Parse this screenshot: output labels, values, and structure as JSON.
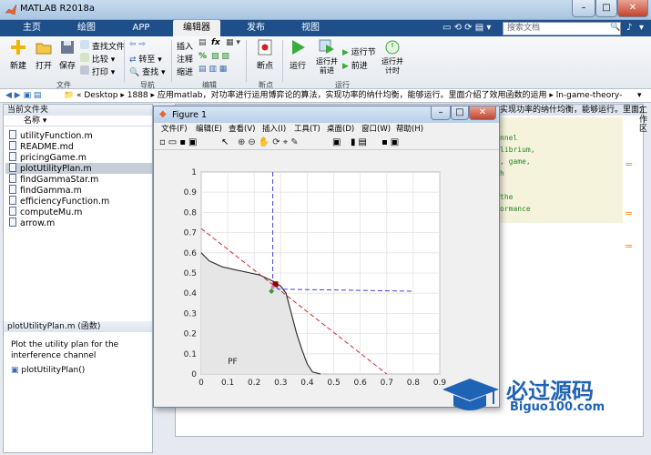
{
  "window": {
    "title": "MATLAB R2018a"
  },
  "tabs": [
    {
      "label": "主页",
      "active": false
    },
    {
      "label": "绘图",
      "active": false
    },
    {
      "label": "APP",
      "active": false
    },
    {
      "label": "编辑器",
      "active": true
    },
    {
      "label": "发布",
      "active": false
    },
    {
      "label": "视图",
      "active": false
    }
  ],
  "search": {
    "placeholder": "搜索文档"
  },
  "ribbon": {
    "new": "新建",
    "open": "打开",
    "save": "保存",
    "find_files": "查找文件",
    "compare": "比较",
    "print": "打印",
    "goto": "转至",
    "find": "查找",
    "insert": "插入",
    "fx": "fx",
    "comment": "注释",
    "indent": "缩进",
    "breakpoints": "断点",
    "run": "运行",
    "run_advance": "运行并\n前进",
    "run_section": "运行节",
    "advance": "前进",
    "run_time": "运行并\n计时",
    "groups": {
      "file": "文件",
      "nav": "导航",
      "edit": "编辑",
      "bp": "断点",
      "run": "运行"
    }
  },
  "address": {
    "path": [
      "Desktop",
      "1888",
      "应用matlab，对功率进行运用博弈论的算法，实现功率的纳什均衡，能够运行。里面介绍了效用函数的运用",
      "ln-game-theory-master"
    ]
  },
  "current_folder": {
    "title": "当前文件夹",
    "col_name": "名称",
    "files": [
      "utilityFunction.m",
      "README.md",
      "pricingGame.m",
      "plotUtilityPlan.m",
      "findGammaStar.m",
      "findGamma.m",
      "efficiencyFunction.m",
      "computeMu.m",
      "arrow.m"
    ],
    "selected": "plotUtilityPlan.m"
  },
  "details": {
    "title": "plotUtilityPlan.m  (函数)",
    "description": "Plot the utility plan for the interference channel",
    "function_sig": "plotUtilityPlan()"
  },
  "editor": {
    "tab_text": "实现功率的纳什均衡，能够运行。里面介绍了效用函数的运用，实现功率的纳...",
    "code_fragments": [
      "nnel",
      "librium,",
      ", game,",
      "h",
      "the",
      "ormance"
    ]
  },
  "side_label": "工作区",
  "figure": {
    "title": "Figure 1",
    "menu": [
      "文件(F)",
      "编辑(E)",
      "查看(V)",
      "插入(I)",
      "工具(T)",
      "桌面(D)",
      "窗口(W)",
      "帮助(H)"
    ]
  },
  "chart_data": {
    "type": "line",
    "title": "",
    "xlabel": "",
    "ylabel": "",
    "xlim": [
      0,
      0.9
    ],
    "ylim": [
      0,
      1
    ],
    "x_ticks": [
      "0",
      "0.1",
      "0.2",
      "0.3",
      "0.4",
      "0.5",
      "0.6",
      "0.7",
      "0.8",
      "0.9"
    ],
    "y_ticks": [
      "0",
      "0.1",
      "0.2",
      "0.3",
      "0.4",
      "0.5",
      "0.6",
      "0.7",
      "0.8",
      "0.9",
      "1"
    ],
    "grid": true,
    "annotation": "PF",
    "series": [
      {
        "style": "region-boundary",
        "color": "#333333",
        "points": [
          [
            0,
            0.6
          ],
          [
            0.03,
            0.56
          ],
          [
            0.08,
            0.53
          ],
          [
            0.15,
            0.51
          ],
          [
            0.22,
            0.49
          ],
          [
            0.27,
            0.46
          ],
          [
            0.3,
            0.435
          ],
          [
            0.32,
            0.4
          ],
          [
            0.34,
            0.3
          ],
          [
            0.36,
            0.2
          ],
          [
            0.38,
            0.12
          ],
          [
            0.4,
            0.05
          ],
          [
            0.42,
            0.01
          ],
          [
            0.45,
            0
          ]
        ]
      },
      {
        "style": "dashed",
        "color": "#d62728",
        "points": [
          [
            0,
            0.72
          ],
          [
            0.7,
            0
          ]
        ]
      },
      {
        "style": "dashed",
        "color": "#4040e0",
        "points": [
          [
            0.27,
            1
          ],
          [
            0.27,
            0.46
          ],
          [
            0.29,
            0.42
          ],
          [
            0.8,
            0.41
          ]
        ]
      }
    ],
    "markers": [
      {
        "x": 0.28,
        "y": 0.445,
        "color": "#8b0000",
        "shape": "square"
      },
      {
        "x": 0.27,
        "y": 0.43,
        "color": "#e377c2",
        "shape": "point"
      },
      {
        "x": 0.265,
        "y": 0.41,
        "color": "#2ca02c",
        "shape": "diamond"
      }
    ]
  },
  "watermark": {
    "brand": "必过源码",
    "url": "Biguo100.com"
  }
}
